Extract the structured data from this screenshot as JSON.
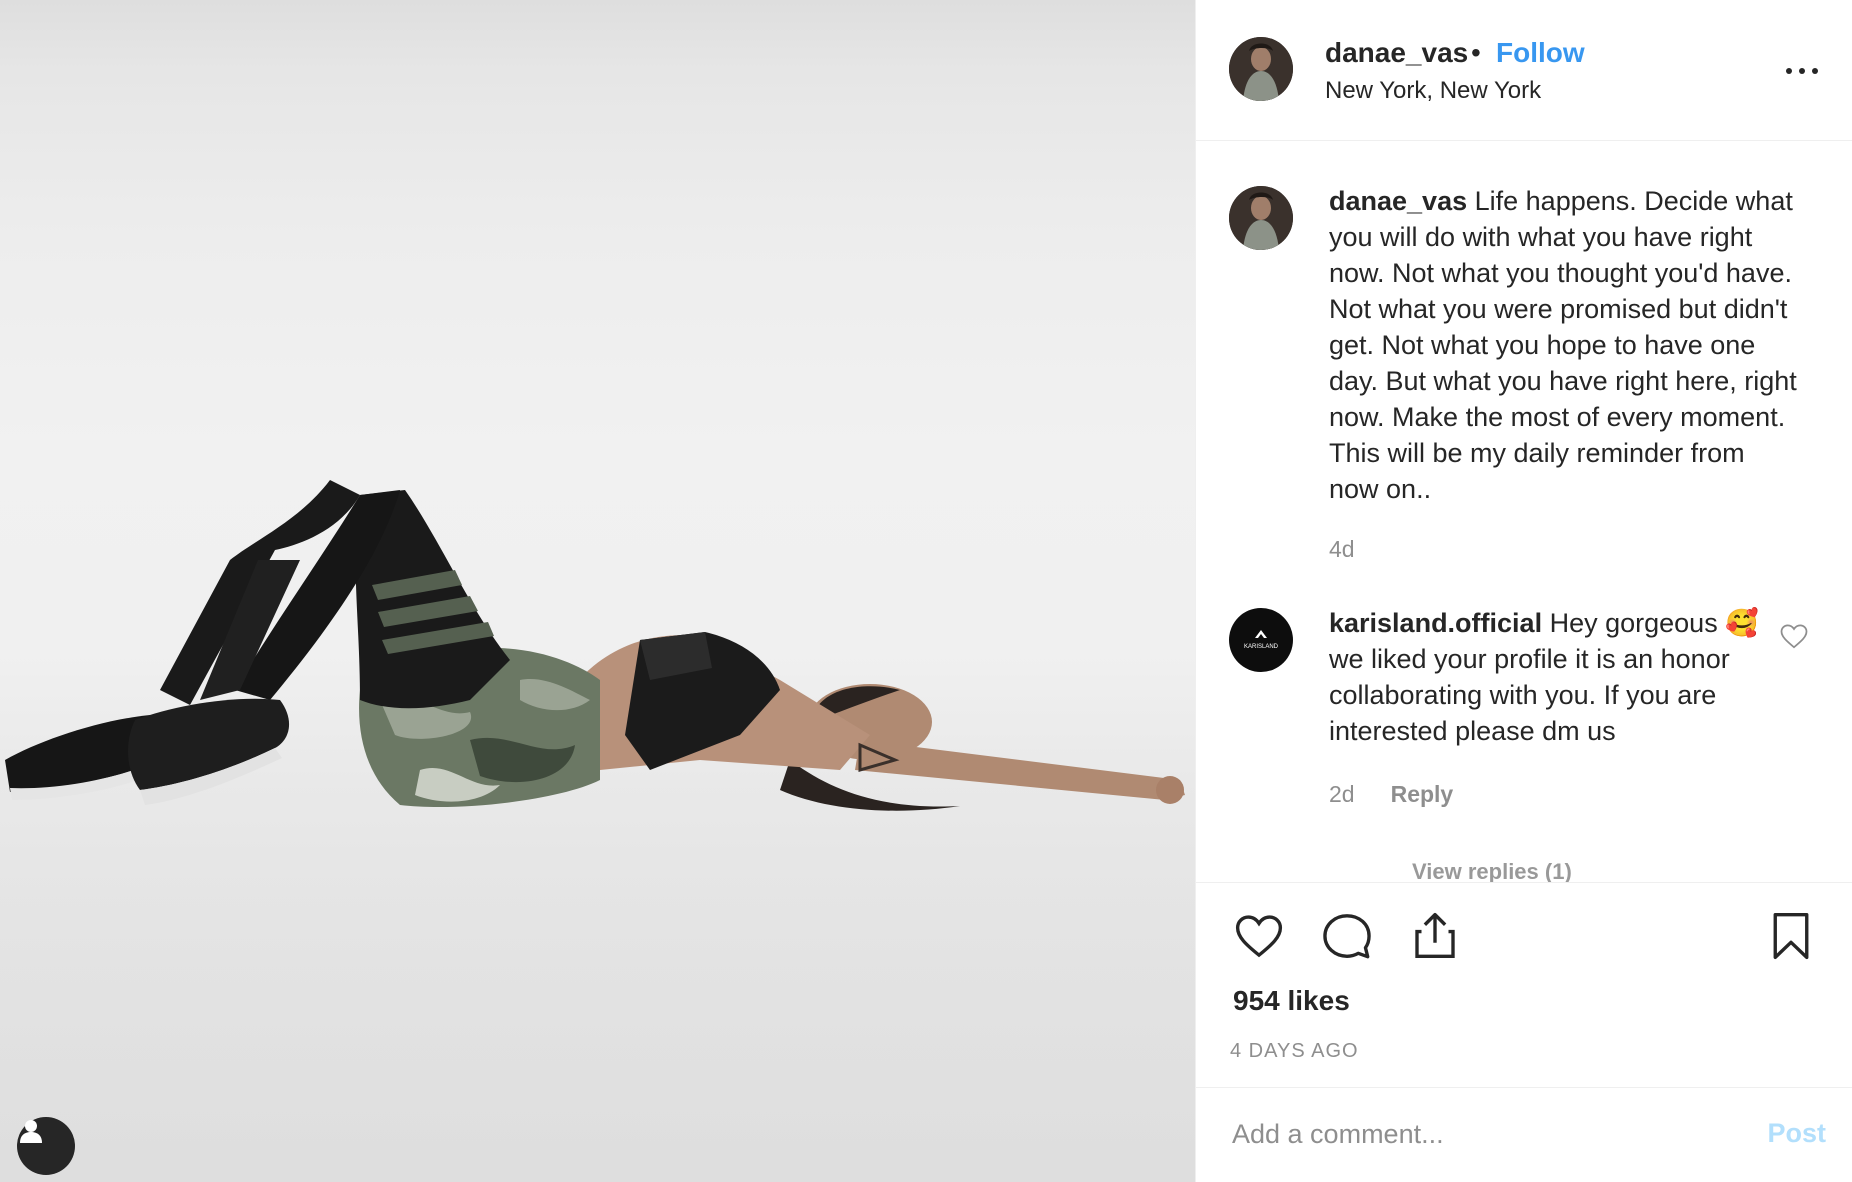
{
  "post": {
    "username": "danae_vas",
    "separator": "•",
    "follow_label": "Follow",
    "location": "New York, New York",
    "more_icon": "more-horizontal-icon"
  },
  "caption": {
    "username": "danae_vas",
    "text": "Life happens. Decide what you will do with what you have right now. Not what you thought you'd have. Not what you were promised but didn't get. Not what you hope to have one day. But what you have right here, right now. Make the most of every moment. This will be my daily reminder from now on..",
    "time": "4d"
  },
  "comments": [
    {
      "username": "karisland.official",
      "text": " we liked your profile it is an honor collaborating with you. If you are interested please dm us",
      "text_prefix": "Hey gorgeous ",
      "emoji": "🥰",
      "avatar_text": "KARISLAND",
      "time": "2d",
      "reply_label": "Reply",
      "view_replies": "View replies (1)"
    }
  ],
  "actions": {
    "likes": "954 likes",
    "time_ago": "4 DAYS AGO"
  },
  "add_comment": {
    "placeholder": "Add a comment...",
    "post_label": "Post"
  },
  "colors": {
    "link_blue": "#3897f0",
    "post_disabled": "#b2dffc",
    "muted": "#8e8e8e",
    "text": "#262626"
  }
}
